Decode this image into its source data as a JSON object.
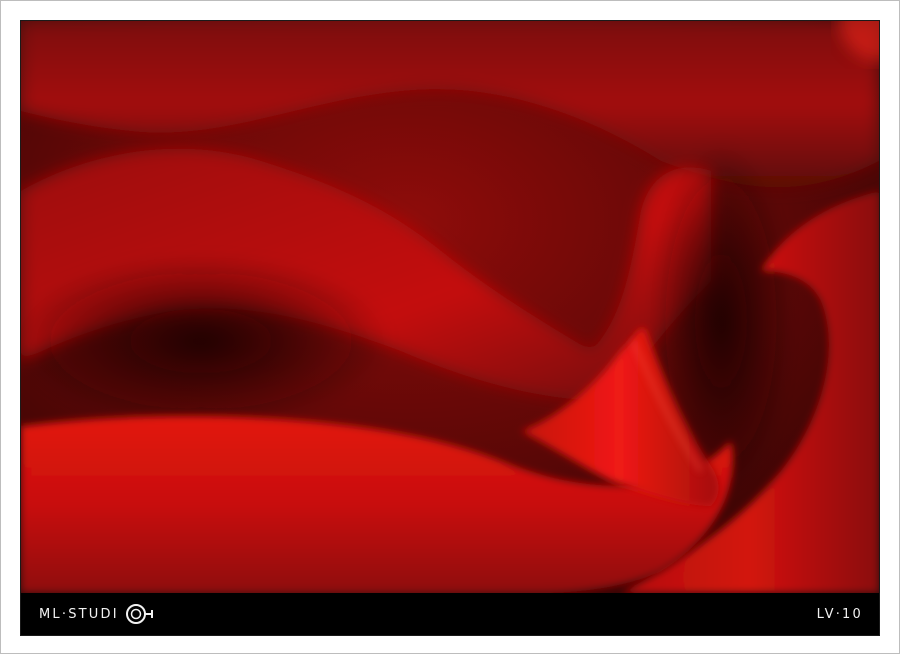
{
  "footer": {
    "brand_text": "ML·STUDI",
    "level_text": "LV·10"
  },
  "icons": {
    "brand_logo": "ring-o-icon"
  },
  "colors": {
    "petal_bright": "#e1120f",
    "petal_mid": "#b30f0c",
    "petal_dark": "#3a0504",
    "bar": "#000000",
    "bar_text": "#f2f2f2"
  }
}
